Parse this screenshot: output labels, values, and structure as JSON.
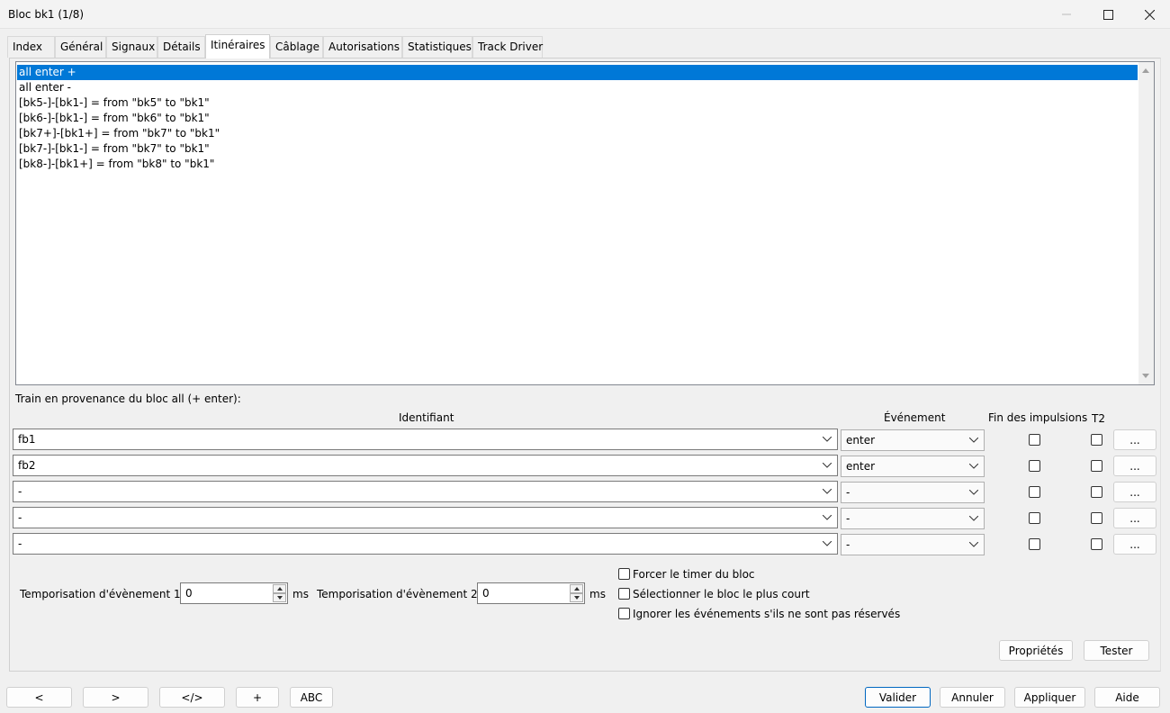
{
  "window": {
    "title": "Bloc bk1 (1/8)"
  },
  "tabs": [
    {
      "label": "Index"
    },
    {
      "label": "Général"
    },
    {
      "label": "Signaux"
    },
    {
      "label": "Détails"
    },
    {
      "label": "Itinéraires"
    },
    {
      "label": "Câblage"
    },
    {
      "label": "Autorisations"
    },
    {
      "label": "Statistiques"
    },
    {
      "label": "Track Driver"
    }
  ],
  "active_tab": "Itinéraires",
  "routes": {
    "items": [
      "all enter +",
      "all enter -",
      "[bk5-]-[bk1-] = from \"bk5\" to \"bk1\"",
      "[bk6-]-[bk1-] = from \"bk6\" to \"bk1\"",
      "[bk7+]-[bk1+] = from \"bk7\" to \"bk1\"",
      "[bk7-]-[bk1-] = from \"bk7\" to \"bk1\"",
      "[bk8-]-[bk1+] = from \"bk8\" to \"bk1\""
    ],
    "selected": "all enter +"
  },
  "train_label": "Train en provenance du bloc all (+ enter):",
  "columns": {
    "identifier": "Identifiant",
    "event": "Événement",
    "end_pulses": "Fin des impulsions",
    "t2": "T2"
  },
  "sensor_rows": [
    {
      "identifier": "fb1",
      "event": "enter",
      "end_pulses": false,
      "t2": false,
      "more": "..."
    },
    {
      "identifier": "fb2",
      "event": "enter",
      "end_pulses": false,
      "t2": false,
      "more": "..."
    },
    {
      "identifier": "-",
      "event": "-",
      "end_pulses": false,
      "t2": false,
      "more": "..."
    },
    {
      "identifier": "-",
      "event": "-",
      "end_pulses": false,
      "t2": false,
      "more": "..."
    },
    {
      "identifier": "-",
      "event": "-",
      "end_pulses": false,
      "t2": false,
      "more": "..."
    }
  ],
  "timers": {
    "timer1_label": "Temporisation d'évènement 1",
    "timer1_value": "0",
    "timer1_unit": "ms",
    "timer2_label": "Temporisation d'évènement 2",
    "timer2_value": "0",
    "timer2_unit": "ms"
  },
  "options": {
    "force_timer": {
      "label": "Forcer le timer du bloc",
      "checked": false
    },
    "select_shortest": {
      "label": "Sélectionner le bloc le plus court",
      "checked": false
    },
    "ignore_events": {
      "label": "Ignorer les événements s'ils ne sont pas réservés",
      "checked": false
    }
  },
  "panel_buttons": {
    "properties": "Propriétés",
    "test": "Tester"
  },
  "bottom_buttons": {
    "prev": "<",
    "next": ">",
    "code": "</>",
    "add": "+",
    "abc": "ABC",
    "ok": "Valider",
    "cancel": "Annuler",
    "apply": "Appliquer",
    "help": "Aide"
  },
  "colors": {
    "selection": "#0078d7",
    "primary_border": "#0067c0"
  }
}
